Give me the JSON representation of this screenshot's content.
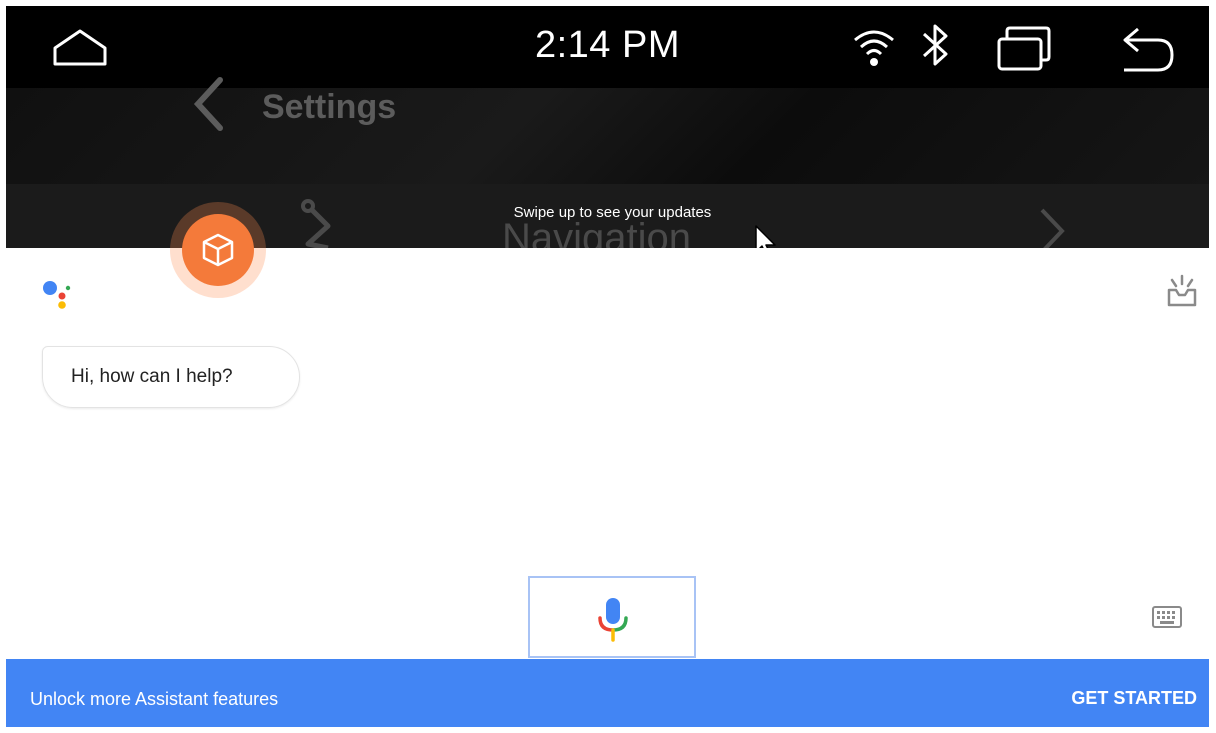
{
  "status_bar": {
    "time": "2:14 PM",
    "icons": [
      "home-icon",
      "wifi-icon",
      "bluetooth-icon",
      "recent-apps-icon",
      "back-icon"
    ]
  },
  "background": {
    "title": "Settings",
    "nav_item_label": "Navigation",
    "hint": "Swipe up to see your updates"
  },
  "assistant": {
    "greeting": "Hi, how can I help?",
    "icons": [
      "google-assistant-logo-icon",
      "updates-tray-icon",
      "microphone-icon",
      "keyboard-icon"
    ]
  },
  "banner": {
    "text": "Unlock more Assistant features",
    "action": "GET STARTED",
    "color": "#4285f4"
  },
  "floating_button": {
    "icon": "cube-icon",
    "color": "#f47a3a"
  }
}
